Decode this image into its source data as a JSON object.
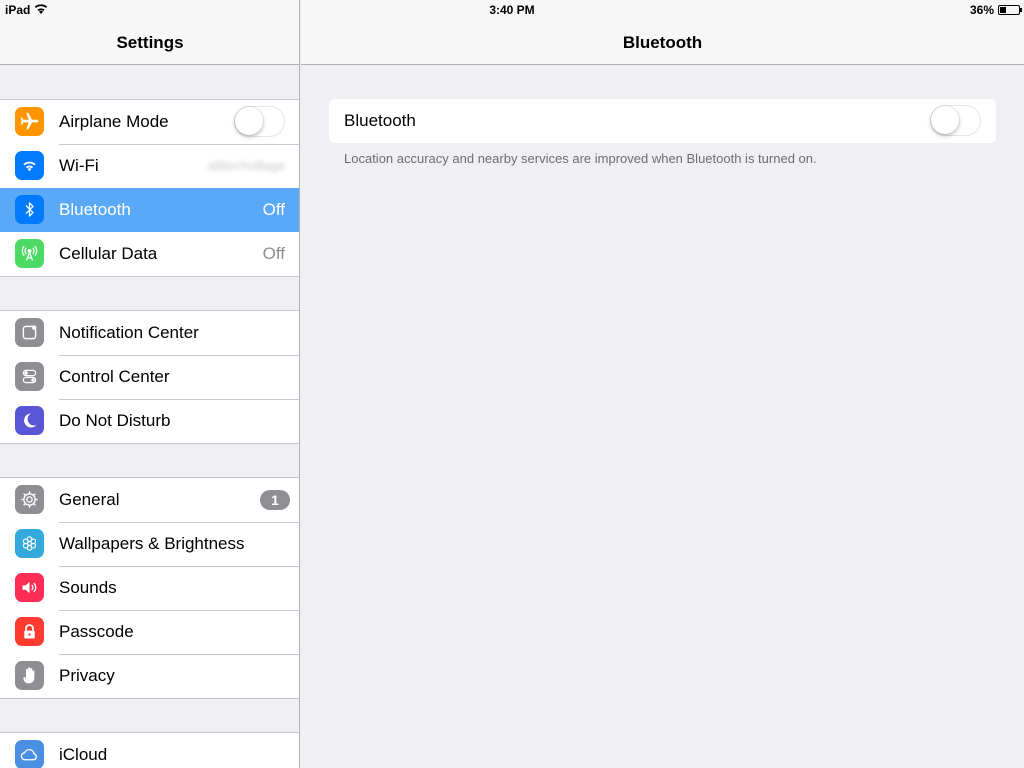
{
  "status_bar": {
    "device": "iPad",
    "time": "3:40 PM",
    "battery_percent": "36%",
    "battery_level": 0.36
  },
  "sidebar": {
    "title": "Settings",
    "groups": [
      {
        "items": [
          {
            "label": "Airplane Mode",
            "icon": "airplane-icon",
            "color": "#ff9500",
            "toggle": false
          },
          {
            "label": "Wi-Fi",
            "icon": "wifi-icon",
            "color": "#007aff",
            "value": "allitechvillage"
          },
          {
            "label": "Bluetooth",
            "icon": "bluetooth-icon",
            "color": "#007aff",
            "value": "Off",
            "selected": true
          },
          {
            "label": "Cellular Data",
            "icon": "antenna-icon",
            "color": "#4cd964",
            "value": "Off"
          }
        ]
      },
      {
        "items": [
          {
            "label": "Notification Center",
            "icon": "notification-icon",
            "color": "#8e8e93"
          },
          {
            "label": "Control Center",
            "icon": "control-center-icon",
            "color": "#8e8e93"
          },
          {
            "label": "Do Not Disturb",
            "icon": "moon-icon",
            "color": "#5856d6"
          }
        ]
      },
      {
        "items": [
          {
            "label": "General",
            "icon": "gear-icon",
            "color": "#8e8e93",
            "badge": "1"
          },
          {
            "label": "Wallpapers & Brightness",
            "icon": "flower-icon",
            "color": "#34aadc"
          },
          {
            "label": "Sounds",
            "icon": "speaker-icon",
            "color": "#ff2d55"
          },
          {
            "label": "Passcode",
            "icon": "lock-icon",
            "color": "#ff3b30"
          },
          {
            "label": "Privacy",
            "icon": "hand-icon",
            "color": "#8e8e93"
          }
        ]
      },
      {
        "items": [
          {
            "label": "iCloud",
            "icon": "cloud-icon",
            "color": "#4a90e2"
          }
        ]
      }
    ]
  },
  "detail": {
    "title": "Bluetooth",
    "bluetooth_label": "Bluetooth",
    "bluetooth_enabled": false,
    "footer": "Location accuracy and nearby services are improved when Bluetooth is turned on."
  }
}
